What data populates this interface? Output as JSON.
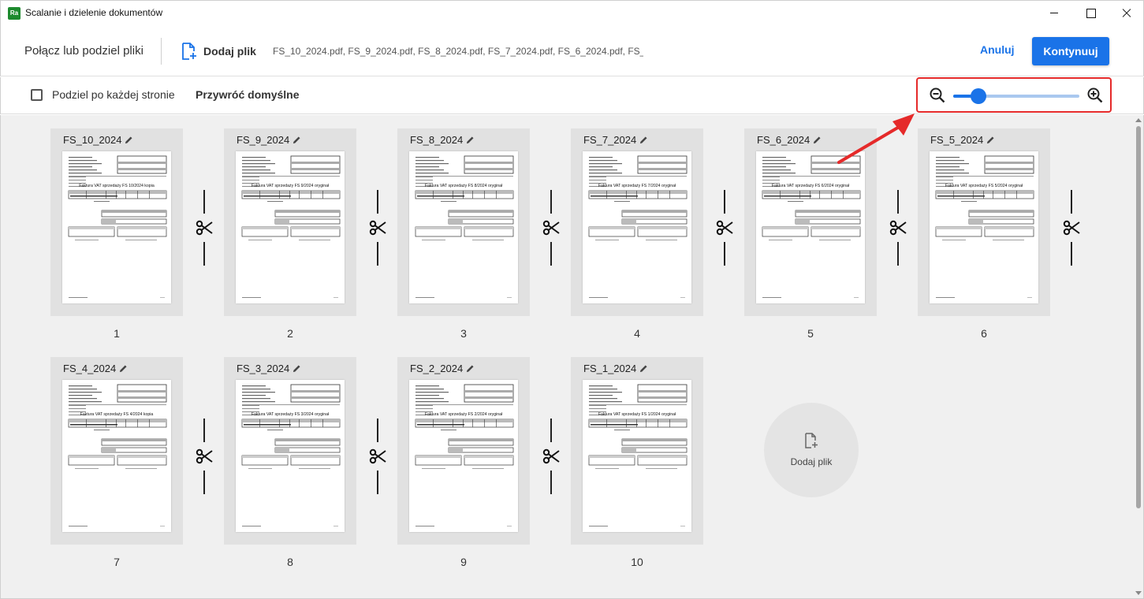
{
  "window": {
    "app_icon_text": "Ra",
    "title": "Scalanie i dzielenie dokumentów"
  },
  "header": {
    "title": "Połącz lub podziel pliki",
    "add_file_label": "Dodaj plik",
    "file_list": "FS_10_2024.pdf, FS_9_2024.pdf, FS_8_2024.pdf, FS_7_2024.pdf, FS_6_2024.pdf, FS_…",
    "cancel_label": "Anuluj",
    "continue_label": "Kontynuuj"
  },
  "options": {
    "split_each_page_label": "Podziel po każdej stronie",
    "split_each_page_checked": false,
    "restore_defaults_label": "Przywróć domyślne",
    "zoom_level": 0.2
  },
  "documents": [
    {
      "name": "FS_10_2024",
      "number": "1",
      "invoice_title": "Faktura VAT sprzedaży FS 10/2024 kopia"
    },
    {
      "name": "FS_9_2024",
      "number": "2",
      "invoice_title": "Faktura VAT sprzedaży FS 9/2024 oryginał"
    },
    {
      "name": "FS_8_2024",
      "number": "3",
      "invoice_title": "Faktura VAT sprzedaży FS 8/2024 oryginał"
    },
    {
      "name": "FS_7_2024",
      "number": "4",
      "invoice_title": "Faktura VAT sprzedaży FS 7/2024 oryginał"
    },
    {
      "name": "FS_6_2024",
      "number": "5",
      "invoice_title": "Faktura VAT sprzedaży FS 6/2024 oryginał"
    },
    {
      "name": "FS_5_2024",
      "number": "6",
      "invoice_title": "Faktura VAT sprzedaży FS 5/2024 oryginał"
    },
    {
      "name": "FS_4_2024",
      "number": "7",
      "invoice_title": "Faktura VAT sprzedaży FS 4/2024 kopia"
    },
    {
      "name": "FS_3_2024",
      "number": "8",
      "invoice_title": "Faktura VAT sprzedaży FS 3/2024 oryginał"
    },
    {
      "name": "FS_2_2024",
      "number": "9",
      "invoice_title": "Faktura VAT sprzedaży FS 2/2024 oryginał"
    },
    {
      "name": "FS_1_2024",
      "number": "10",
      "invoice_title": "Faktura VAT sprzedaży FS 1/2024 oryginał"
    }
  ],
  "add_tile": {
    "label": "Dodaj plik"
  },
  "colors": {
    "accent": "#1a73e8",
    "highlight": "#e52a2a",
    "card_bg": "#e1e1e1",
    "content_bg": "#f0f0f0"
  },
  "icons": [
    "add-file-icon",
    "pencil-icon",
    "scissors-icon",
    "zoom-out-icon",
    "zoom-in-icon"
  ]
}
